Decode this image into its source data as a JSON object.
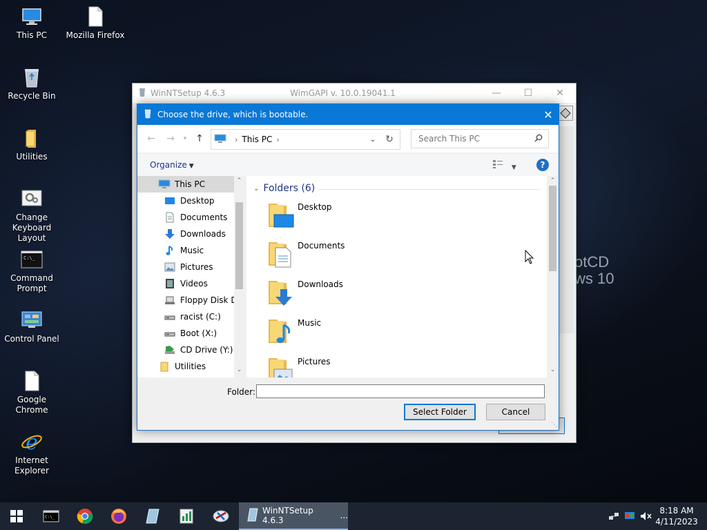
{
  "desktop": {
    "icons": [
      {
        "label": "This PC",
        "icon": "computer-icon"
      },
      {
        "label": "Mozilla Firefox",
        "icon": "file-icon"
      },
      {
        "label": "Recycle Bin",
        "icon": "recycle-bin-icon"
      },
      {
        "label": "Utilities",
        "icon": "folder-icon"
      },
      {
        "label": "Change Keyboard Layout",
        "icon": "keyboard-settings-icon"
      },
      {
        "label": "Command Prompt",
        "icon": "terminal-icon"
      },
      {
        "label": "Control Panel",
        "icon": "control-panel-icon"
      },
      {
        "label": "Google Chrome",
        "icon": "file-icon"
      },
      {
        "label": "Internet Explorer",
        "icon": "internet-explorer-icon"
      }
    ],
    "watermark_line1": "otCD",
    "watermark_line2": "ws 10"
  },
  "bg_window": {
    "title": "WinNTSetup 4.6.3",
    "subtitle": "WimGAPI v. 10.0.19041.1",
    "minimize": "—",
    "maximize": "☐",
    "close": "✕"
  },
  "dialog": {
    "title": "Choose the drive, which is bootable.",
    "close": "✕",
    "address": {
      "crumb": "This PC"
    },
    "search_placeholder": "Search This PC",
    "organize": "Organize",
    "nav_items": [
      {
        "label": "This PC",
        "icon": "computer-icon"
      },
      {
        "label": "Desktop",
        "icon": "desktop-icon"
      },
      {
        "label": "Documents",
        "icon": "documents-icon"
      },
      {
        "label": "Downloads",
        "icon": "downloads-icon"
      },
      {
        "label": "Music",
        "icon": "music-icon"
      },
      {
        "label": "Pictures",
        "icon": "pictures-icon"
      },
      {
        "label": "Videos",
        "icon": "videos-icon"
      },
      {
        "label": "Floppy Disk Dri",
        "icon": "floppy-icon"
      },
      {
        "label": "racist (C:)",
        "icon": "drive-icon"
      },
      {
        "label": "Boot (X:)",
        "icon": "drive-icon"
      },
      {
        "label": "CD Drive (Y:) C",
        "icon": "cd-drive-icon"
      },
      {
        "label": "Utilities",
        "icon": "folder-icon"
      }
    ],
    "group_header": "Folders (6)",
    "folders": [
      {
        "name": "Desktop",
        "overlay": "desktop"
      },
      {
        "name": "Documents",
        "overlay": "documents"
      },
      {
        "name": "Downloads",
        "overlay": "downloads"
      },
      {
        "name": "Music",
        "overlay": "music"
      },
      {
        "name": "Pictures",
        "overlay": "pictures"
      }
    ],
    "folder_label": "Folder:",
    "folder_value": "",
    "select_button": "Select Folder",
    "cancel_button": "Cancel"
  },
  "taskbar": {
    "active_app": "WinNTSetup 4.6.3",
    "active_app_ellipsis": "...",
    "time": "8:18 AM",
    "date": "4/11/2023"
  },
  "colors": {
    "accent": "#0a78d7",
    "folder_yellow": "#f8d775",
    "taskbar": "#1b2430"
  }
}
